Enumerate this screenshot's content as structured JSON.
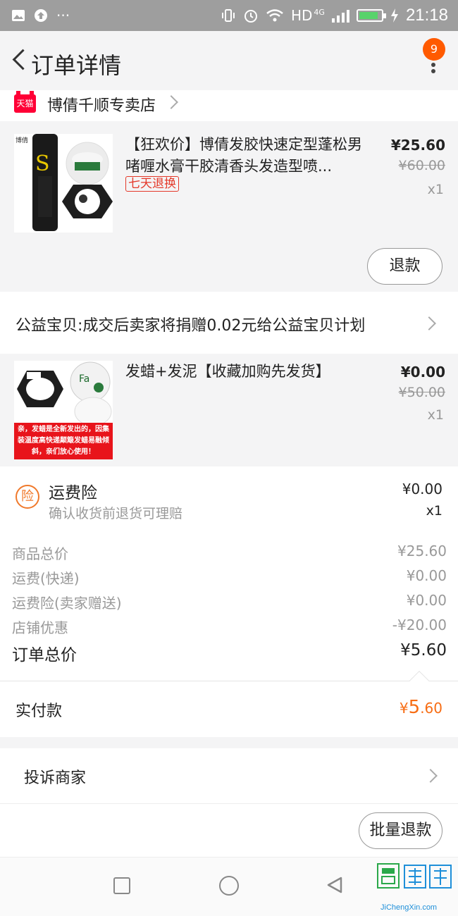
{
  "status_bar": {
    "network_label": "HD",
    "network_type": "4G",
    "time": "21:18"
  },
  "nav": {
    "title": "订单详情",
    "badge_count": "9"
  },
  "shop": {
    "tmall_label": "天猫",
    "name": "博倩千顺专卖店"
  },
  "products": [
    {
      "name": "【狂欢价】博倩发胶快速定型蓬松男啫喱水膏干胶清香头发造型喷...",
      "tag": "七天退换",
      "price": "¥25.60",
      "original_price": "¥60.00",
      "quantity": "x1",
      "refund_label": "退款"
    },
    {
      "name": "发蜡+发泥【收藏加购先发货】",
      "price": "¥0.00",
      "original_price": "¥50.00",
      "quantity": "x1",
      "image_caption": "亲，发蜡是全新发出的，因集装温度高快递颠簸发蜡易融倾斜，亲们放心使用！"
    }
  ],
  "charity": {
    "text": "公益宝贝:成交后卖家将捐赠0.02元给公益宝贝计划"
  },
  "insurance": {
    "icon_label": "险",
    "title": "运费险",
    "subtitle": "确认收货前退货可理赔",
    "amount": "¥0.00",
    "quantity": "x1"
  },
  "summary": {
    "rows": [
      {
        "label": "商品总价",
        "value": "¥25.60"
      },
      {
        "label": "运费(快递)",
        "value": "¥0.00"
      },
      {
        "label": "运费险(卖家赠送)",
        "value": "¥0.00"
      },
      {
        "label": "店铺优惠",
        "value": "-¥20.00"
      }
    ],
    "total_label": "订单总价",
    "total_value": "¥5.60"
  },
  "paid": {
    "label": "实付款",
    "currency": "¥",
    "amount_int": "5",
    "amount_dec": ".60"
  },
  "complain": {
    "label": "投诉商家"
  },
  "bottom": {
    "bulk_refund_label": "批量退款"
  },
  "watermark": {
    "text": "JiChengXin.com"
  },
  "colors": {
    "accent_orange": "#f76d14",
    "tmall_red": "#ff0036",
    "badge_orange": "#ff5a00",
    "tag_red": "#e4392a"
  }
}
